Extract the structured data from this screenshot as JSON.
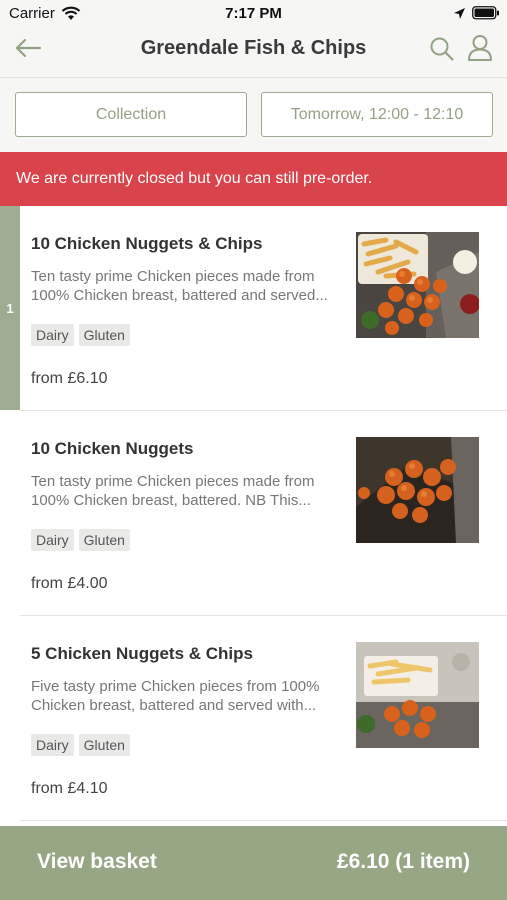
{
  "status_bar": {
    "carrier": "Carrier",
    "time": "7:17 PM"
  },
  "header": {
    "title": "Greendale Fish & Chips"
  },
  "order_options": {
    "collection": "Collection",
    "time_slot": "Tomorrow, 12:00 - 12:10"
  },
  "banner": {
    "message": "We are currently closed but you can still pre-order."
  },
  "items": [
    {
      "quantity": "1",
      "name": "10 Chicken Nuggets & Chips",
      "description_line1": "Ten tasty prime Chicken pieces made from",
      "description_line2": "100% Chicken breast, battered and served...",
      "tags": [
        "Dairy",
        "Gluten"
      ],
      "price": "from £6.10"
    },
    {
      "name": "10 Chicken Nuggets",
      "description_line1": "Ten tasty prime Chicken pieces made from",
      "description_line2": "100% Chicken breast, battered. NB This...",
      "tags": [
        "Dairy",
        "Gluten"
      ],
      "price": "from £4.00"
    },
    {
      "name": "5 Chicken Nuggets & Chips",
      "description_line1": "Five tasty prime Chicken pieces from 100%",
      "description_line2": "Chicken breast, battered and served with...",
      "tags": [
        "Dairy",
        "Gluten"
      ],
      "price": "from £4.10"
    }
  ],
  "basket": {
    "label": "View basket",
    "total": "£6.10 (1 item)"
  },
  "colors": {
    "accent_green": "#9eac8f",
    "banner_red": "#d9434c",
    "basket_green": "#97a685"
  }
}
